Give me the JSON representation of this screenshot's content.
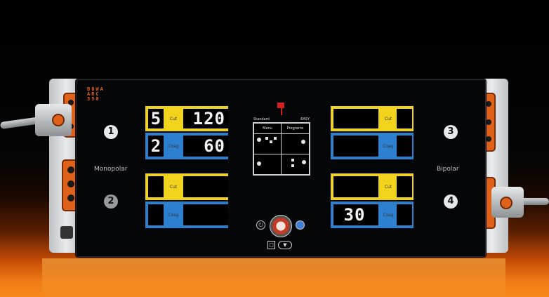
{
  "device": {
    "brand_lines": [
      "BOWA",
      "ARC",
      "350"
    ],
    "left_label": "Monopolar",
    "right_label": "Bipolar",
    "outputs": [
      "1",
      "2",
      "3",
      "4"
    ]
  },
  "channels": {
    "ch1_cut": {
      "mode_digit": "5",
      "tag": "Cut",
      "value": "120"
    },
    "ch1_coag": {
      "mode_digit": "2",
      "tag": "Coag",
      "value": "60"
    },
    "ch2_cut": {
      "tag": "Cut"
    },
    "ch2_coag": {
      "tag": "Coag"
    },
    "ch3_cut": {
      "tag": "Cut"
    },
    "ch3_coag": {
      "tag": "Coag"
    },
    "ch4_cut": {
      "tag": "Cut"
    },
    "ch4_coag": {
      "tag": "Coag",
      "value": "30"
    }
  },
  "center_screen": {
    "header_left": "Standard",
    "header_right": "EASY",
    "menu_label": "Menu",
    "programs_label": "Programs"
  },
  "colors": {
    "accent_orange": "#e0621a",
    "cut_yellow": "#f2d31b",
    "coag_blue": "#2d7fd0",
    "power_red": "#c23a25"
  },
  "icons": [
    "standby-icon",
    "power-button",
    "neutral-electrode-icon",
    "footswitch-icon",
    "wireless-icon"
  ]
}
